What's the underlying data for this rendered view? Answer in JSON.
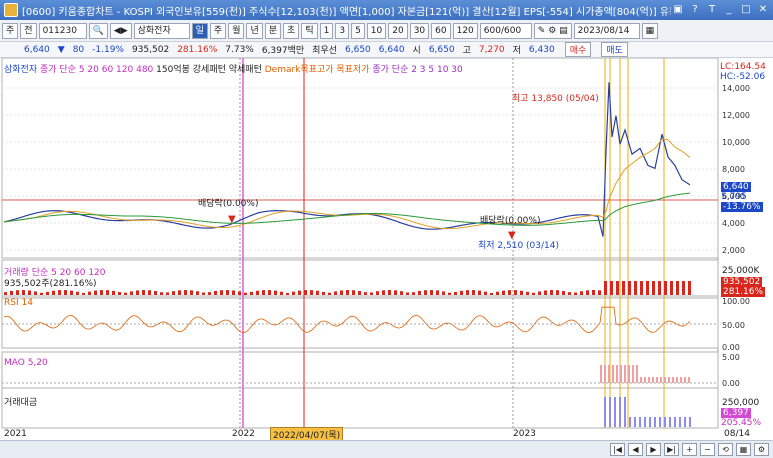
{
  "window": {
    "title": "[0600] 키움종합차트 - KOSPI 외국인보유[559(천)] 주식수[12,103(천)] 액면[1,000] 자본금[121(억)] 결산[12월] EPS[-554] 시가총액[804(억)] 유동",
    "controls": [
      "□",
      "?",
      "T",
      "_",
      "□",
      "X"
    ]
  },
  "toolbar": {
    "mode": "주",
    "market": "전",
    "code": "011230",
    "stock_name": "삼화전자",
    "periods": [
      "일",
      "주",
      "월",
      "년",
      "분",
      "초",
      "틱"
    ],
    "active_period": "일",
    "intervals": [
      "1",
      "3",
      "5",
      "10",
      "20",
      "30",
      "60",
      "120"
    ],
    "count": "600/600",
    "date": "2023/08/14"
  },
  "quote": {
    "price": "6,640",
    "change": "80",
    "change_pct": "-1.19%",
    "volume": "935,502",
    "volume_ratio": "281.16%",
    "turnover": "7.73%",
    "amount": "6,397백만",
    "foreign_label": "최우선",
    "ask": "6,650",
    "bid": "6,640",
    "open_label": "시",
    "open": "6,650",
    "high_label": "고",
    "high": "7,270",
    "low_label": "저",
    "low": "6,430",
    "buy_btn": "매수",
    "sell_btn": "매도"
  },
  "price_panel": {
    "title": "삼화전자",
    "indicators": "종가 단순 5  20  60  120  480",
    "pattern": "150억봉 강세패턴  약세패턴",
    "demark": "Demark목표고가  목표저가",
    "close_ma": "종가 단순 2  3  5  10  30",
    "lc": "LC:164.54",
    "hc": "HC:-52.06",
    "high_note": "최고 13,850 (05/04)",
    "low_note": "최저 2,510 (03/14)",
    "div1": "배당락(0.00%)",
    "div2": "배당락(0.00%)",
    "last_price": "6,640",
    "last_hi": "5,795",
    "last_pct": "-13.76%",
    "y_ticks": [
      "14,000",
      "12,000",
      "10,000",
      "8,000",
      "6,000",
      "4,000",
      "2,000"
    ]
  },
  "volume_panel": {
    "title": "거래량 단순 5  20  60  120",
    "value": "935,502주(281.16%)",
    "tick": "25,000K",
    "last": "935,502",
    "last_pct": "281.16%"
  },
  "rsi_panel": {
    "title": "RSI 14",
    "ticks": [
      "100.00",
      "50.00",
      "0.00"
    ]
  },
  "mao_panel": {
    "title": "MAO 5,20",
    "ticks": [
      "5.00",
      "0.00"
    ]
  },
  "amount_panel": {
    "title": "거래대금",
    "tick": "250,000",
    "last": "6,397",
    "last_pct": "205.45%"
  },
  "x_axis": {
    "labels": [
      "2021",
      "2022",
      "2023",
      "08/14"
    ],
    "cursor_date": "2022/04/07(목)"
  }
}
